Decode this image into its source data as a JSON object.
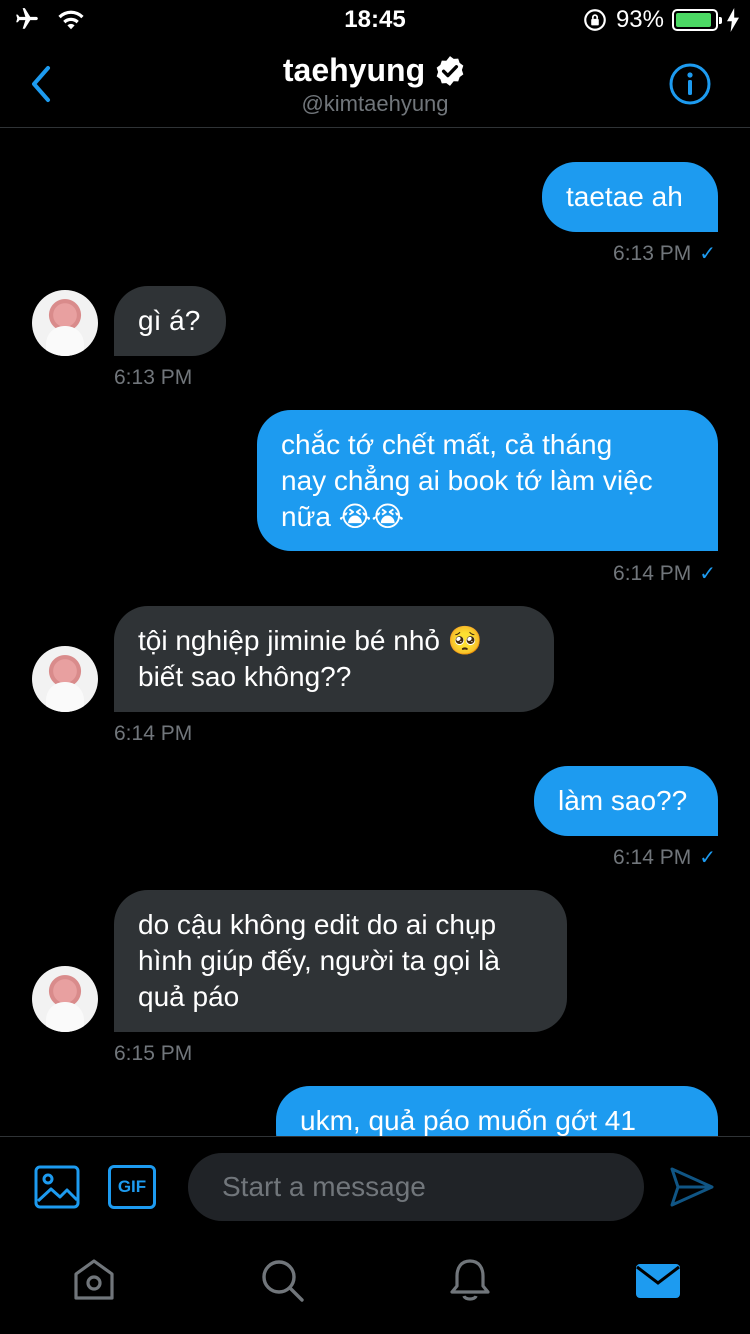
{
  "status_bar": {
    "time": "18:45",
    "battery_percent_text": "93%",
    "battery_level": 0.93,
    "icons": [
      "airplane-icon",
      "wifi-icon",
      "rotation-lock-icon",
      "battery-icon",
      "charging-icon"
    ]
  },
  "header": {
    "title": "taehyung",
    "handle": "@kimtaehyung",
    "verified": true,
    "back_icon": "chevron-left-icon",
    "info_icon": "info-icon"
  },
  "messages": [
    {
      "direction": "out",
      "lines": [
        "taetae ah"
      ],
      "time": "6:13 PM",
      "read": true
    },
    {
      "direction": "in",
      "lines": [
        "gì á?"
      ],
      "time": "6:13 PM"
    },
    {
      "direction": "out",
      "lines": [
        "chắc tớ chết mất, cả tháng",
        "nay chẳng ai book tớ làm việc",
        "nữa 😭😭"
      ],
      "time": "6:14 PM",
      "read": true
    },
    {
      "direction": "in",
      "lines": [
        "tội nghiệp jiminie bé nhỏ 🥺",
        "biết sao không??"
      ],
      "time": "6:14 PM"
    },
    {
      "direction": "out",
      "lines": [
        "làm sao??"
      ],
      "time": "6:14 PM",
      "read": true
    },
    {
      "direction": "in",
      "lines": [
        "do cậu không edit do ai chụp",
        "hình giúp đếy, người ta gọi là",
        "quả páo"
      ],
      "time": "6:15 PM"
    },
    {
      "direction": "out",
      "lines": [
        "ukm, quả páo muốn gớt 41"
      ]
    }
  ],
  "composer": {
    "placeholder": "Start a message",
    "gif_label": "GIF",
    "image_icon": "image-icon",
    "send_icon": "send-icon"
  },
  "tab_bar": {
    "tabs": [
      {
        "name": "home",
        "icon": "home-icon",
        "active": false
      },
      {
        "name": "search",
        "icon": "search-icon",
        "active": false
      },
      {
        "name": "notifications",
        "icon": "bell-icon",
        "active": false
      },
      {
        "name": "messages",
        "icon": "mail-icon",
        "active": true
      }
    ]
  },
  "colors": {
    "accent": "#1d9bf0",
    "background": "#000000",
    "incoming_bubble": "#2f3336",
    "muted_text": "#71767b"
  }
}
